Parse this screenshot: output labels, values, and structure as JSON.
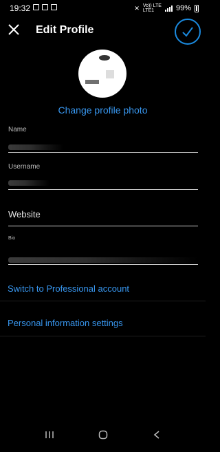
{
  "status_bar": {
    "time": "19:32",
    "battery_pct": "99%",
    "network_label": "Vo)) LTE",
    "network_sub": "LTE1"
  },
  "header": {
    "title": "Edit Profile",
    "close_icon": "close-icon",
    "save_icon": "check-icon",
    "accent_color": "#1b8be0"
  },
  "profile": {
    "change_photo_label": "Change profile photo"
  },
  "fields": {
    "name_label": "Name",
    "username_label": "Username",
    "website_placeholder": "Website",
    "bio_label": "Bio"
  },
  "links": {
    "professional": "Switch to Professional account",
    "personal_info": "Personal information settings"
  },
  "nav": {
    "recent_icon": "recent-apps-icon",
    "home_icon": "home-icon",
    "back_icon": "back-icon"
  }
}
